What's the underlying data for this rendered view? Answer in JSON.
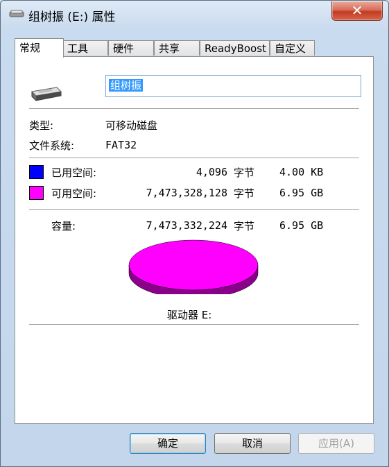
{
  "window": {
    "title": "组树振 (E:) 属性",
    "close_glyph": "✕"
  },
  "tabs": [
    {
      "label": "常规",
      "active": true
    },
    {
      "label": "工具",
      "active": false
    },
    {
      "label": "硬件",
      "active": false
    },
    {
      "label": "共享",
      "active": false
    },
    {
      "label": "ReadyBoost",
      "active": false
    },
    {
      "label": "自定义",
      "active": false
    }
  ],
  "general": {
    "drive_name": "组树振",
    "type_label": "类型:",
    "type_value": "可移动磁盘",
    "fs_label": "文件系统:",
    "fs_value": "FAT32",
    "used_label": "已用空间:",
    "used_bytes": "4,096",
    "used_unit": "字节",
    "used_human": "4.00 KB",
    "free_label": "可用空间:",
    "free_bytes": "7,473,328,128",
    "free_unit": "字节",
    "free_human": "6.95 GB",
    "capacity_label": "容量:",
    "capacity_bytes": "7,473,332,224",
    "capacity_unit": "字节",
    "capacity_human": "6.95 GB",
    "drive_caption": "驱动器 E:",
    "used_color": "#0000ff",
    "free_color": "#ff00ff",
    "free_shadow_color": "#8b008b",
    "used_fraction": 5e-07
  },
  "buttons": {
    "ok": "确定",
    "cancel": "取消",
    "apply": "应用(A)"
  }
}
